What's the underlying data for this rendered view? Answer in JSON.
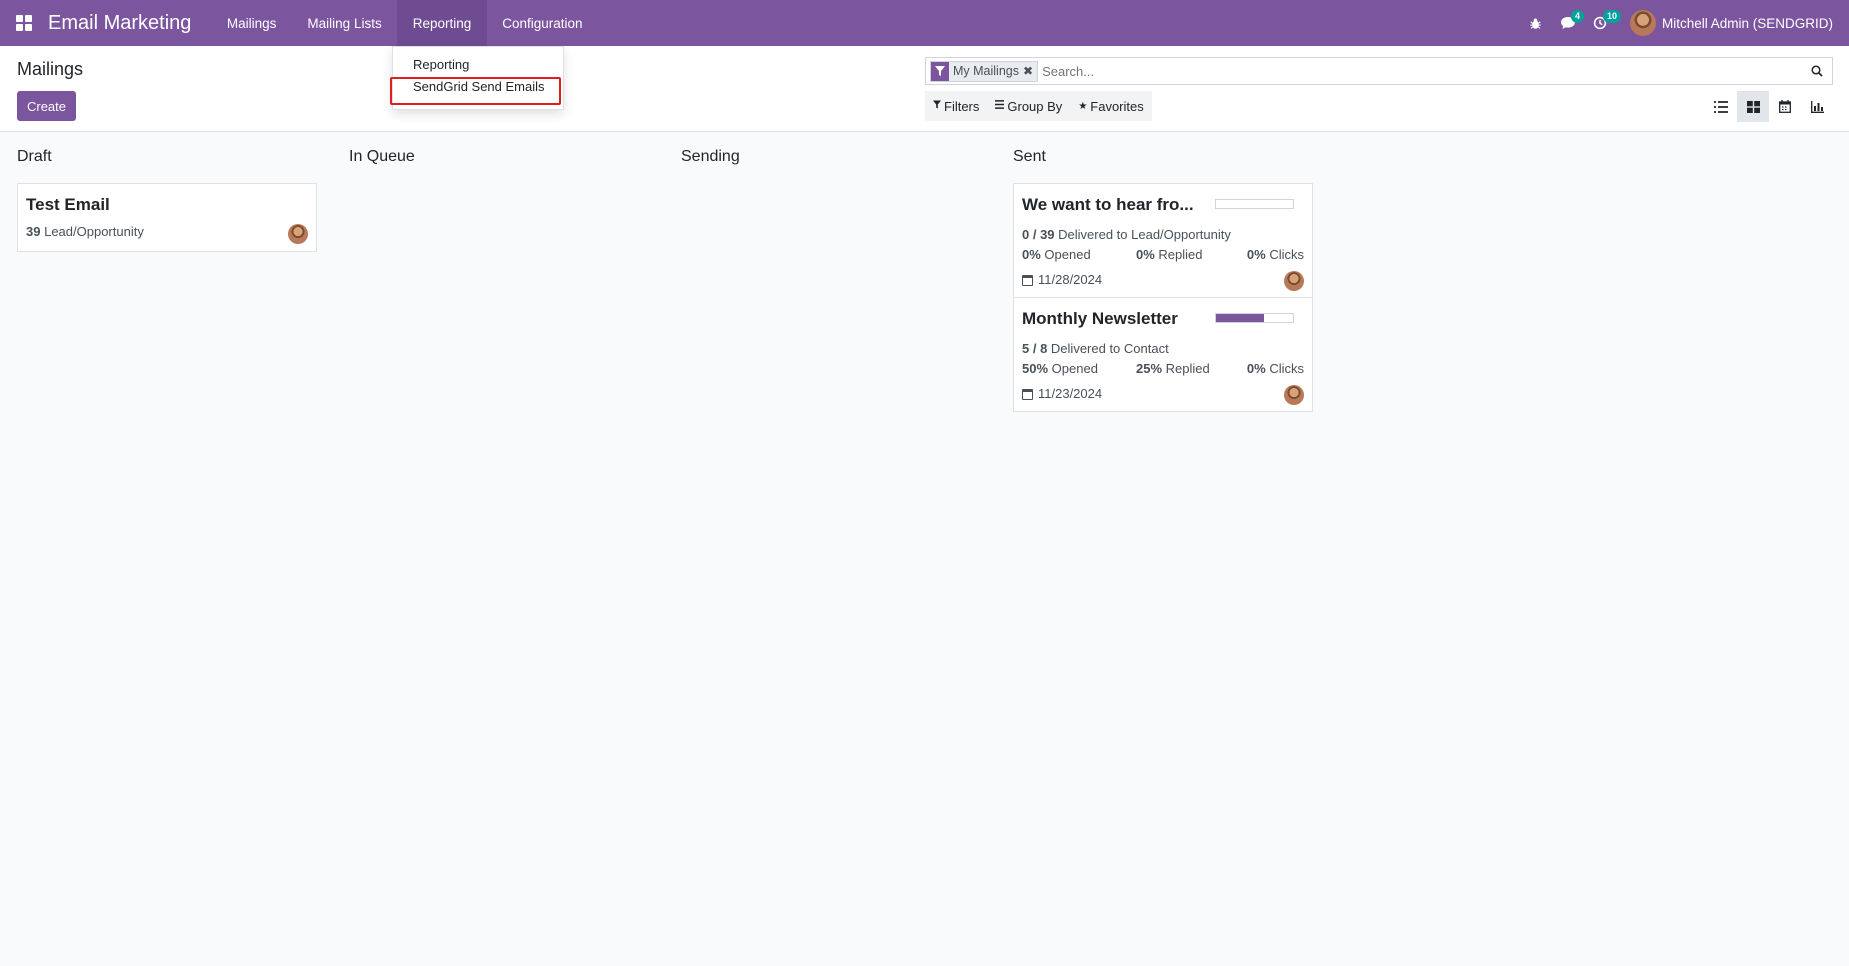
{
  "navbar": {
    "app_title": "Email Marketing",
    "menu": [
      "Mailings",
      "Mailing Lists",
      "Reporting",
      "Configuration"
    ],
    "messages_count": "4",
    "activities_count": "10",
    "user": "Mitchell Admin (SENDGRID)"
  },
  "dropdown": {
    "items": [
      "Reporting",
      "SendGrid Send Emails"
    ]
  },
  "control": {
    "title": "Mailings",
    "create_label": "Create",
    "facet_label": "My Mailings",
    "search_placeholder": "Search...",
    "filters_label": "Filters",
    "groupby_label": "Group By",
    "favorites_label": "Favorites"
  },
  "kanban": {
    "columns": [
      {
        "title": "Draft"
      },
      {
        "title": "In Queue"
      },
      {
        "title": "Sending"
      },
      {
        "title": "Sent"
      }
    ],
    "draft_card": {
      "title": "Test Email",
      "count": "39",
      "target": "Lead/Opportunity"
    },
    "sent_cards": [
      {
        "title": "We want to hear fro...",
        "delivered": "0 / 39",
        "delivered_text": "Delivered to Lead/Opportunity",
        "opened": "0%",
        "opened_label": "Opened",
        "replied": "0%",
        "replied_label": "Replied",
        "clicks": "0%",
        "clicks_label": "Clicks",
        "date": "11/28/2024",
        "progress": 0
      },
      {
        "title": "Monthly Newsletter",
        "delivered": "5 / 8",
        "delivered_text": "Delivered to Contact",
        "opened": "50%",
        "opened_label": "Opened",
        "replied": "25%",
        "replied_label": "Replied",
        "clicks": "0%",
        "clicks_label": "Clicks",
        "date": "11/23/2024",
        "progress": 0.62
      }
    ]
  },
  "colors": {
    "brand": "#7c559f",
    "badge": "#00a09d",
    "highlight": "#e01e1e"
  }
}
